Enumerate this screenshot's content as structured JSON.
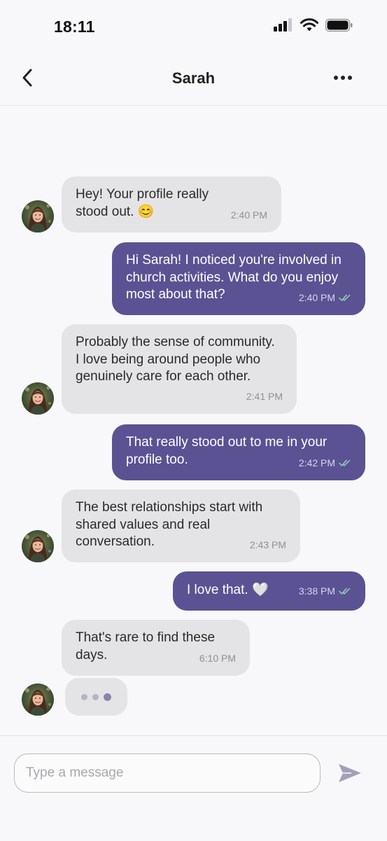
{
  "status_bar": {
    "time": "18:11",
    "icons": [
      "signal-icon",
      "wifi-icon",
      "battery-icon"
    ]
  },
  "header": {
    "title": "Sarah",
    "back_icon": "chevron-left-icon",
    "more_icon": "more-horizontal-icon"
  },
  "messages": [
    {
      "sender": "Sarah",
      "text": "Hey! Your profile really stood out. 😊",
      "time": "2:40 PM"
    },
    {
      "sender": "me",
      "text": "Hi Sarah! I noticed you're involved in church activities. What do you enjoy most about that?",
      "time": "2:40 PM",
      "read": true
    },
    {
      "sender": "Sarah",
      "text": "Probably the sense of community. I love being around people who genuinely care for each other.",
      "time": "2:41 PM"
    },
    {
      "sender": "me",
      "text": "That really stood out to me in your profile too.",
      "time": "2:42 PM",
      "read": true
    },
    {
      "sender": "Sarah",
      "text": "The best relationships start with shared values and real conversation.",
      "time": "2:43 PM"
    },
    {
      "sender": "me",
      "text": "I love that. 🤍",
      "time": "3:38 PM",
      "read": true
    },
    {
      "sender": "Sarah",
      "text": "That's rare to find these days.",
      "time": "6:10 PM"
    }
  ],
  "typing_indicator": {
    "visible": true
  },
  "composer": {
    "placeholder": "Type a message",
    "value": "",
    "send_icon": "send-icon"
  },
  "colors": {
    "outgoing_bubble": "#5b5293",
    "incoming_bubble": "#e4e4e6",
    "read_check": "#8fd6b4",
    "background": "#f8f8fa"
  }
}
